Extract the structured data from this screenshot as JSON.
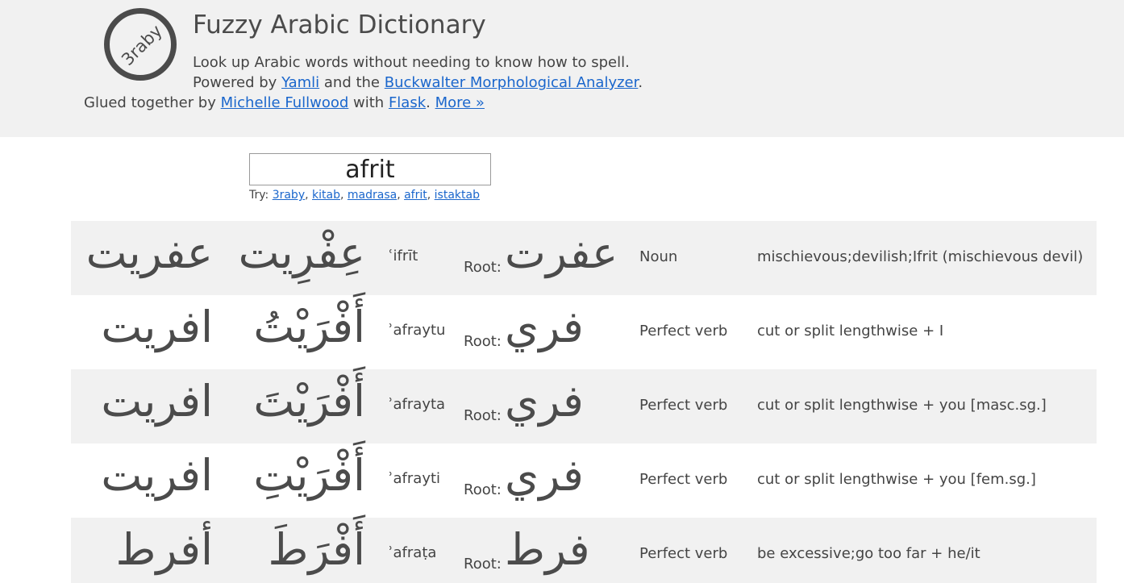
{
  "header": {
    "logo_text": "3raby",
    "title": "Fuzzy Arabic Dictionary",
    "subtitle": "Look up Arabic words without needing to know how to spell.",
    "powered_prefix": "Powered by ",
    "yamli_link": "Yamli",
    "powered_mid": " and the ",
    "buckwalter_link": "Buckwalter Morphological Analyzer",
    "powered_suffix": ".",
    "glued_prefix": "Glued together by ",
    "author_link": "Michelle Fullwood",
    "glued_mid": " with ",
    "flask_link": "Flask",
    "glued_sep": ". ",
    "more_link": "More »"
  },
  "search": {
    "value": "afrit",
    "try_prefix": "Try: ",
    "examples": [
      "3raby",
      "kitab",
      "madrasa",
      "afrit",
      "istaktab"
    ],
    "separator": ", "
  },
  "results": {
    "root_label": "Root: ",
    "rows": [
      {
        "word": "عفريت",
        "vocalized": "عِفْرِيت",
        "translit": "ʿifrīt",
        "root": "عفرت",
        "pos": "Noun",
        "gloss": "mischievous;devilish;Ifrit (mischievous devil)"
      },
      {
        "word": "افريت",
        "vocalized": "أَفْرَيْتُ",
        "translit": "ʾafraytu",
        "root": "فري",
        "pos": "Perfect verb",
        "gloss": "cut or split lengthwise + I"
      },
      {
        "word": "افريت",
        "vocalized": "أَفْرَيْتَ",
        "translit": "ʾafrayta",
        "root": "فري",
        "pos": "Perfect verb",
        "gloss": "cut or split lengthwise + you [masc.sg.]"
      },
      {
        "word": "افريت",
        "vocalized": "أَفْرَيْتِ",
        "translit": "ʾafrayti",
        "root": "فري",
        "pos": "Perfect verb",
        "gloss": "cut or split lengthwise + you [fem.sg.]"
      },
      {
        "word": "أفرط",
        "vocalized": "أَفْرَطَ",
        "translit": "ʾafraṭa",
        "root": "فرط",
        "pos": "Perfect verb",
        "gloss": "be excessive;go too far + he/it"
      }
    ]
  },
  "colors": {
    "link": "#1a66cc",
    "header_bg": "#f1f1f1",
    "row_shade": "#f1f1f1",
    "text": "#444444"
  }
}
